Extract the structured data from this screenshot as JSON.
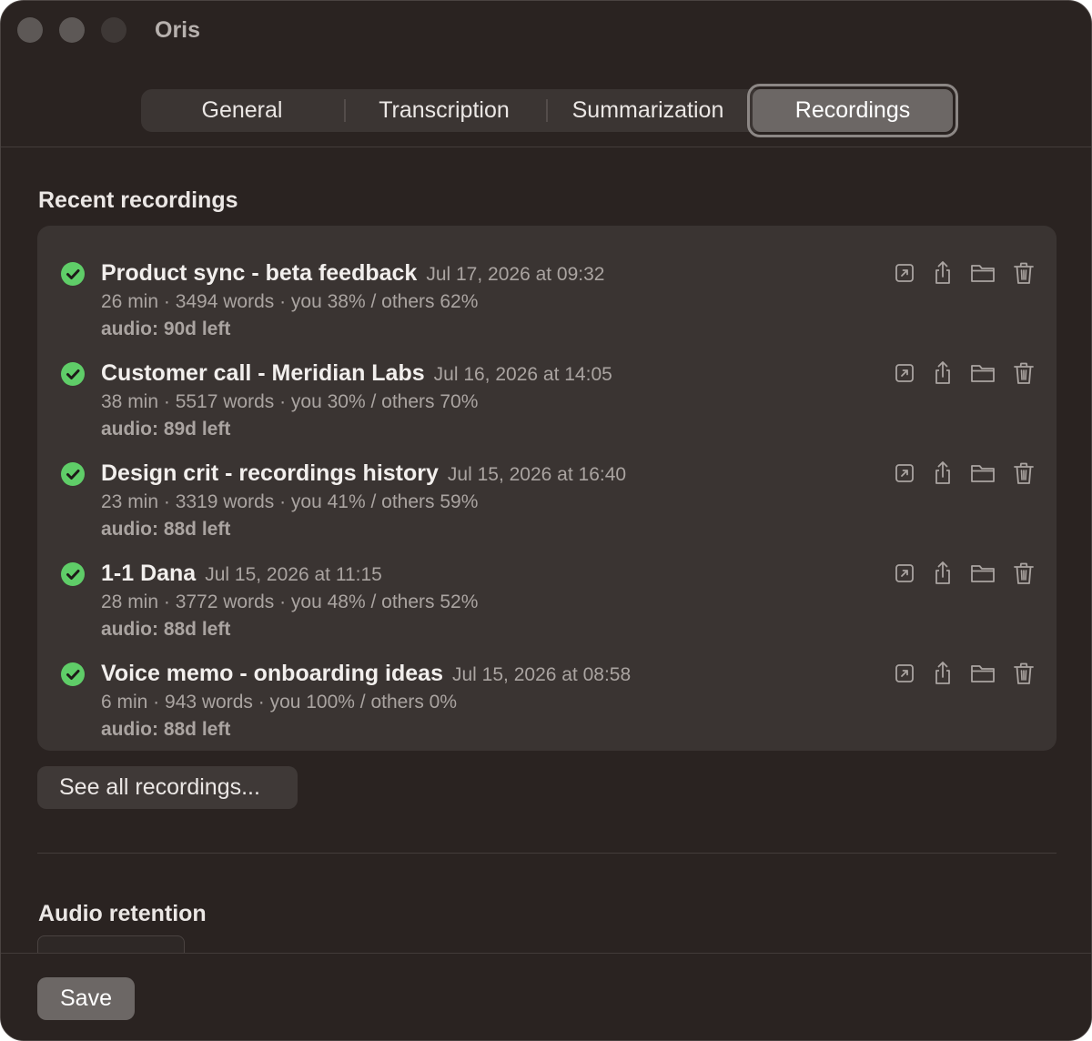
{
  "app": {
    "title": "Oris"
  },
  "tabs": [
    {
      "label": "General"
    },
    {
      "label": "Transcription"
    },
    {
      "label": "Summarization"
    },
    {
      "label": "Recordings",
      "active": true
    }
  ],
  "recent": {
    "title": "Recent recordings",
    "items": [
      {
        "title": "Product sync - beta feedback",
        "date": "Jul 17, 2026 at 09:32",
        "meta": "26 min · 3494 words · you 38% / others 62%",
        "audio": "audio: 90d left"
      },
      {
        "title": "Customer call - Meridian Labs",
        "date": "Jul 16, 2026 at 14:05",
        "meta": "38 min · 5517 words · you 30% / others 70%",
        "audio": "audio: 89d left"
      },
      {
        "title": "Design crit - recordings history",
        "date": "Jul 15, 2026 at 16:40",
        "meta": "23 min · 3319 words · you 41% / others 59%",
        "audio": "audio: 88d left"
      },
      {
        "title": "1-1 Dana",
        "date": "Jul 15, 2026 at 11:15",
        "meta": "28 min · 3772 words · you 48% / others 52%",
        "audio": "audio: 88d left"
      },
      {
        "title": "Voice memo - onboarding ideas",
        "date": "Jul 15, 2026 at 08:58",
        "meta": "6 min · 943 words · you 100% / others 0%",
        "audio": "audio: 88d left"
      }
    ],
    "see_all_label": "See all recordings..."
  },
  "retention": {
    "title": "Audio retention"
  },
  "footer": {
    "save_label": "Save"
  },
  "icons": {
    "status": "check-circle-icon",
    "actions": [
      "open-external-icon",
      "share-icon",
      "folder-icon",
      "trash-icon"
    ]
  },
  "colors": {
    "status_ok": "#5fcd68",
    "window_bg": "#2a2321",
    "card_bg": "#3a3432"
  }
}
